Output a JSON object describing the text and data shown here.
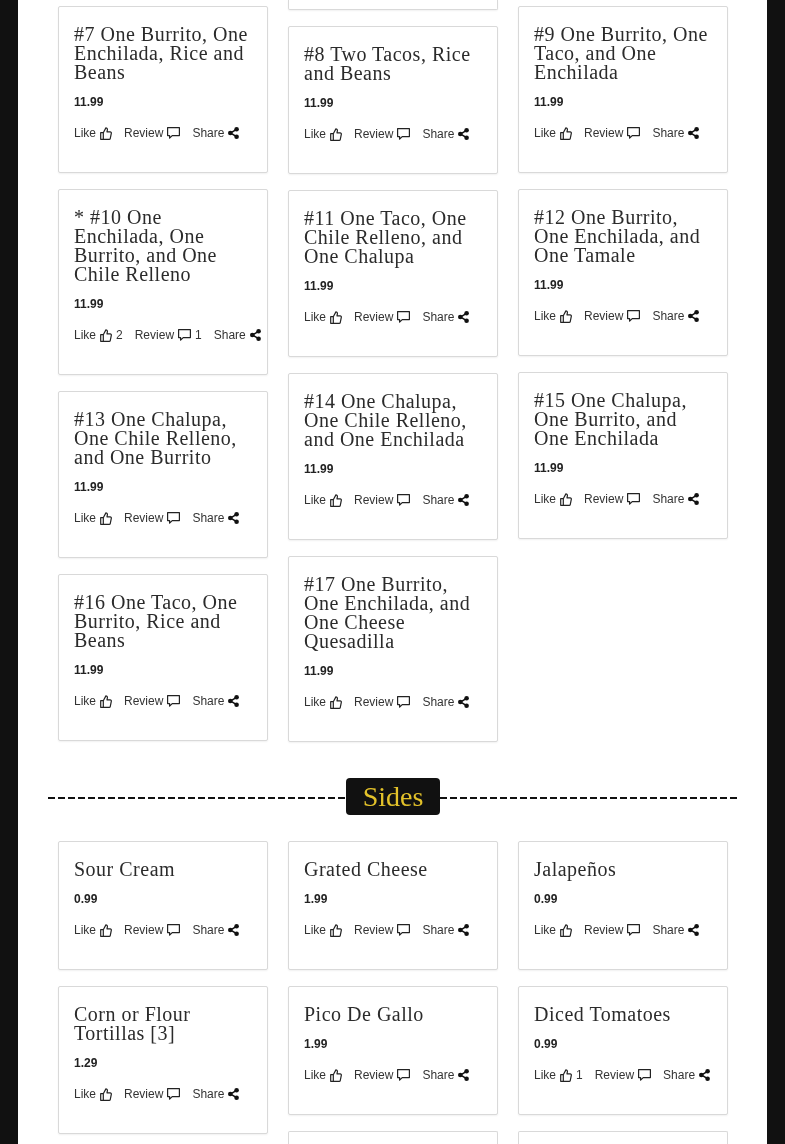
{
  "sections": [
    {
      "columns": [
        {
          "cards": [
            {
              "kind": "dish",
              "name": "#7 One Burrito, One Enchilada, Rice and Beans",
              "price": "11.99",
              "actions": [
                {
                  "kind": "like",
                  "label": "Like"
                },
                {
                  "kind": "review",
                  "label": "Review"
                },
                {
                  "kind": "share",
                  "label": "Share"
                }
              ]
            },
            {
              "kind": "dish",
              "name": "* #10 One Enchilada, One Burrito, and One Chile Relleno",
              "price": "11.99",
              "actions": [
                {
                  "kind": "like",
                  "label": "Like",
                  "count": "2"
                },
                {
                  "kind": "review",
                  "label": "Review",
                  "count": "1"
                },
                {
                  "kind": "share",
                  "label": "Share"
                }
              ]
            },
            {
              "kind": "dish",
              "name": "#13 One Chalupa, One Chile Relleno, and One Burrito",
              "price": "11.99",
              "actions": [
                {
                  "kind": "like",
                  "label": "Like"
                },
                {
                  "kind": "review",
                  "label": "Review"
                },
                {
                  "kind": "share",
                  "label": "Share"
                }
              ]
            },
            {
              "kind": "dish",
              "name": "#16 One Taco, One Burrito, Rice and Beans",
              "price": "11.99",
              "actions": [
                {
                  "kind": "like",
                  "label": "Like"
                },
                {
                  "kind": "review",
                  "label": "Review"
                },
                {
                  "kind": "share",
                  "label": "Share"
                }
              ]
            }
          ]
        },
        {
          "cards": [
            {
              "kind": "cut_off"
            },
            {
              "kind": "dish",
              "name": "#8 Two Tacos, Rice and Beans",
              "price": "11.99",
              "actions": [
                {
                  "kind": "like",
                  "label": "Like"
                },
                {
                  "kind": "review",
                  "label": "Review"
                },
                {
                  "kind": "share",
                  "label": "Share"
                }
              ]
            },
            {
              "kind": "dish",
              "name": "#11 One Taco, One Chile Relleno, and One Chalupa",
              "price": "11.99",
              "actions": [
                {
                  "kind": "like",
                  "label": "Like"
                },
                {
                  "kind": "review",
                  "label": "Review"
                },
                {
                  "kind": "share",
                  "label": "Share"
                }
              ]
            },
            {
              "kind": "dish",
              "name": "#14 One Chalupa, One Chile Relleno, and One Enchilada",
              "price": "11.99",
              "actions": [
                {
                  "kind": "like",
                  "label": "Like"
                },
                {
                  "kind": "review",
                  "label": "Review"
                },
                {
                  "kind": "share",
                  "label": "Share"
                }
              ]
            },
            {
              "kind": "dish",
              "name": "#17 One Burrito, One Enchilada, and One Cheese Quesadilla",
              "price": "11.99",
              "actions": [
                {
                  "kind": "like",
                  "label": "Like"
                },
                {
                  "kind": "review",
                  "label": "Review"
                },
                {
                  "kind": "share",
                  "label": "Share"
                }
              ]
            }
          ]
        },
        {
          "cards": [
            {
              "kind": "dish",
              "name": "#9 One Burrito, One Taco, and One Enchilada",
              "price": "11.99",
              "actions": [
                {
                  "kind": "like",
                  "label": "Like"
                },
                {
                  "kind": "review",
                  "label": "Review"
                },
                {
                  "kind": "share",
                  "label": "Share"
                }
              ]
            },
            {
              "kind": "dish",
              "name": "#12 One Burrito, One Enchilada, and One Tamale",
              "price": "11.99",
              "actions": [
                {
                  "kind": "like",
                  "label": "Like"
                },
                {
                  "kind": "review",
                  "label": "Review"
                },
                {
                  "kind": "share",
                  "label": "Share"
                }
              ]
            },
            {
              "kind": "dish",
              "name": "#15 One Chalupa, One Burrito, and One Enchilada",
              "price": "11.99",
              "actions": [
                {
                  "kind": "like",
                  "label": "Like"
                },
                {
                  "kind": "review",
                  "label": "Review"
                },
                {
                  "kind": "share",
                  "label": "Share"
                }
              ]
            }
          ]
        }
      ]
    },
    {
      "title": "Sides",
      "columns": [
        {
          "cards": [
            {
              "kind": "dish",
              "name": "Sour Cream",
              "price": "0.99",
              "actions": [
                {
                  "kind": "like",
                  "label": "Like"
                },
                {
                  "kind": "review",
                  "label": "Review"
                },
                {
                  "kind": "share",
                  "label": "Share"
                }
              ]
            },
            {
              "kind": "dish",
              "name": "Corn or Flour Tortillas [3]",
              "price": "1.29",
              "actions": [
                {
                  "kind": "like",
                  "label": "Like"
                },
                {
                  "kind": "review",
                  "label": "Review"
                },
                {
                  "kind": "share",
                  "label": "Share"
                }
              ]
            }
          ]
        },
        {
          "cards": [
            {
              "kind": "dish",
              "name": "Grated Cheese",
              "price": "1.99",
              "actions": [
                {
                  "kind": "like",
                  "label": "Like"
                },
                {
                  "kind": "review",
                  "label": "Review"
                },
                {
                  "kind": "share",
                  "label": "Share"
                }
              ]
            },
            {
              "kind": "dish",
              "name": "Pico De Gallo",
              "price": "1.99",
              "actions": [
                {
                  "kind": "like",
                  "label": "Like"
                },
                {
                  "kind": "review",
                  "label": "Review"
                },
                {
                  "kind": "share",
                  "label": "Share"
                }
              ]
            },
            {
              "kind": "cut_off"
            }
          ]
        },
        {
          "cards": [
            {
              "kind": "dish",
              "name": "Jalapeños",
              "price": "0.99",
              "actions": [
                {
                  "kind": "like",
                  "label": "Like"
                },
                {
                  "kind": "review",
                  "label": "Review"
                },
                {
                  "kind": "share",
                  "label": "Share"
                }
              ]
            },
            {
              "kind": "dish",
              "name": "Diced Tomatoes",
              "price": "0.99",
              "actions": [
                {
                  "kind": "like",
                  "label": "Like",
                  "count": "1"
                },
                {
                  "kind": "review",
                  "label": "Review"
                },
                {
                  "kind": "share",
                  "label": "Share"
                }
              ]
            },
            {
              "kind": "cut_off"
            }
          ]
        }
      ]
    }
  ]
}
